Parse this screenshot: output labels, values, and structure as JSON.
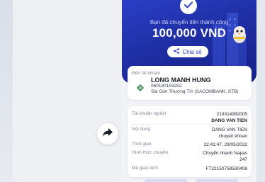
{
  "receipt": {
    "success_text": "Bạn đã chuyển tiền thành công",
    "amount": "100,000 VND",
    "share_label": "Chia sẻ"
  },
  "destination": {
    "label": "Đến tài khoản",
    "name": "LONG MANH HUNG",
    "account": "060180153252",
    "bank": "Sài Gòn Thương Tín (SACOMBANK, STB)"
  },
  "details": {
    "source_label": "Tài khoản nguồn",
    "source_account": "219314982005",
    "source_name": "DANG VAN TIEN",
    "content_label": "Nội dung",
    "content_line1": "DANG VAN TIEN",
    "content_line2": "chuyen khoan",
    "time_label": "Thời gian",
    "time_value": "22:41:47, 29/05/2022",
    "method_label": "Hình thức chuyển",
    "method_line1": "Chuyển nhanh Napas",
    "method_line2": "247",
    "txn_label": "Mã giao dịch",
    "txn_value": "FT22150758590408"
  },
  "icons": {
    "check": "check-icon",
    "share": "share-icon",
    "forward": "forward-arrow-icon",
    "bank": "sacombank-logo-icon"
  },
  "colors": {
    "hero_blue": "#2b3ec7",
    "background": "#f1f3f7"
  }
}
